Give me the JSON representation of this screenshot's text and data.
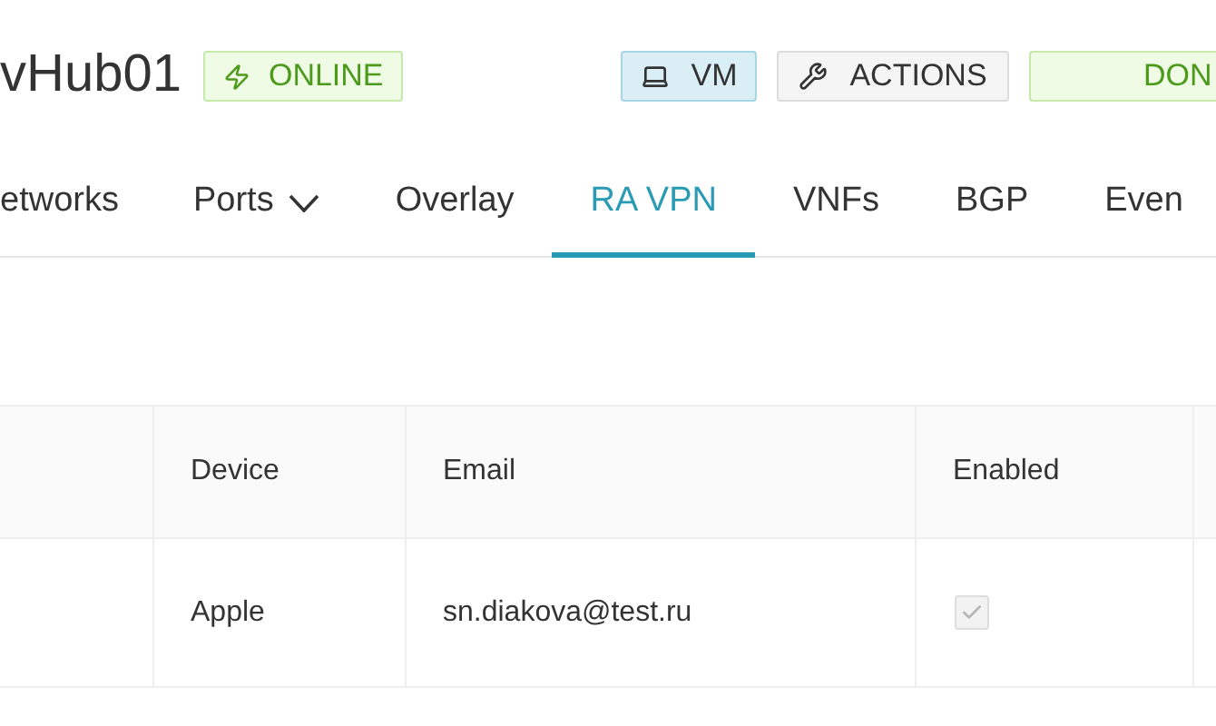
{
  "header": {
    "title": "vHub01",
    "status": "ONLINE",
    "buttons": [
      {
        "kind": "vm",
        "label": "VM"
      },
      {
        "kind": "actions",
        "label": "ACTIONS"
      },
      {
        "kind": "done",
        "label": "DON"
      }
    ]
  },
  "tabs": [
    {
      "label": "etworks",
      "selected": false,
      "dropdown": false
    },
    {
      "label": "Ports",
      "selected": false,
      "dropdown": true
    },
    {
      "label": "Overlay",
      "selected": false,
      "dropdown": false
    },
    {
      "label": "RA VPN",
      "selected": true,
      "dropdown": false
    },
    {
      "label": "VNFs",
      "selected": false,
      "dropdown": false
    },
    {
      "label": "BGP",
      "selected": false,
      "dropdown": false
    },
    {
      "label": "Even",
      "selected": false,
      "dropdown": false
    }
  ],
  "table": {
    "columns": [
      "Device",
      "Email",
      "Enabled"
    ],
    "rows": [
      {
        "device": "Apple",
        "email": "sn.diakova@test.ru",
        "enabled": true
      }
    ]
  }
}
